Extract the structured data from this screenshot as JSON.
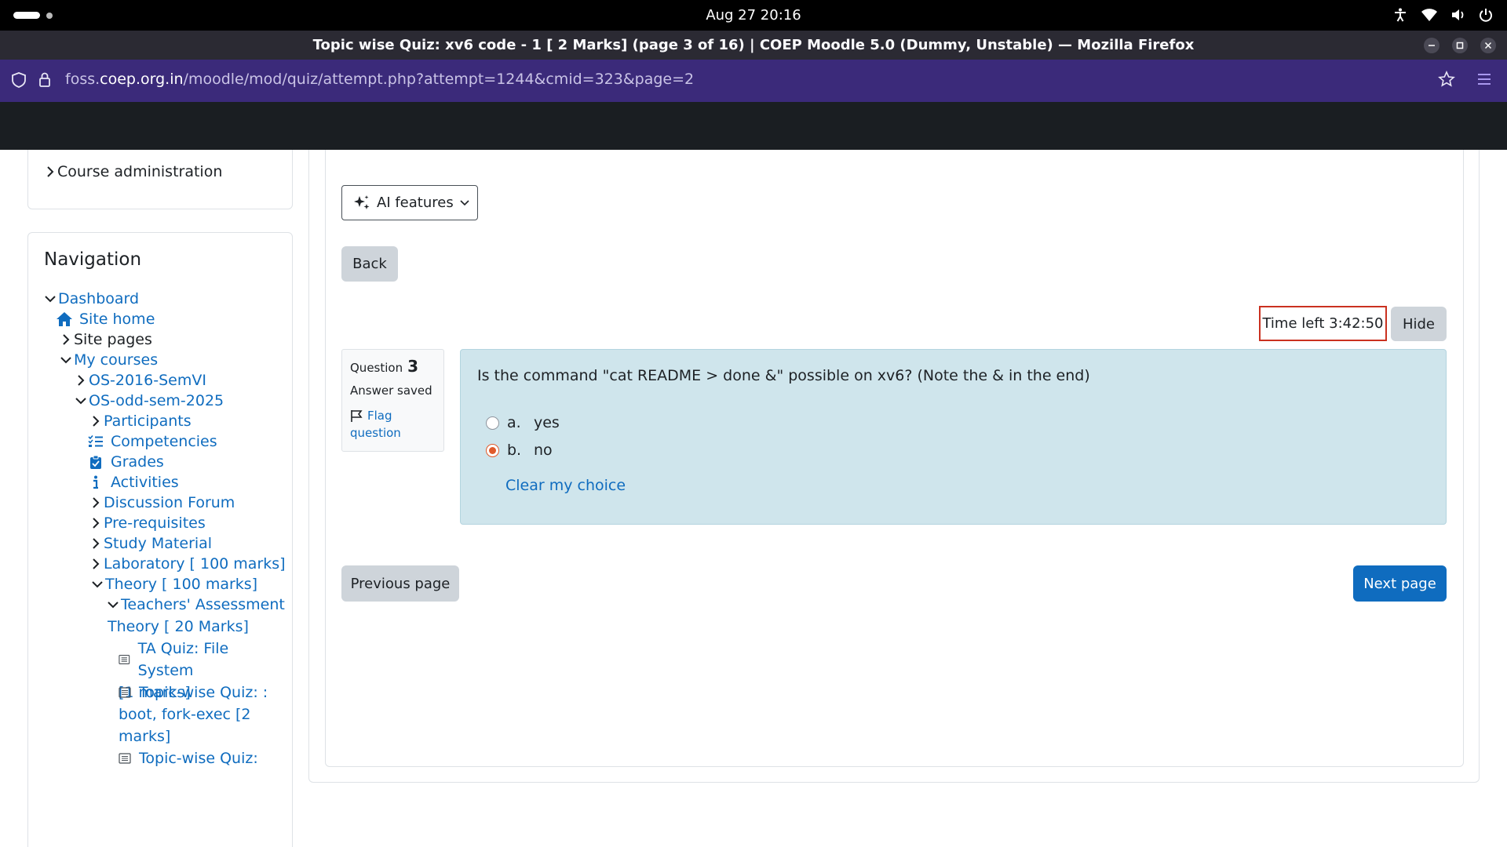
{
  "system": {
    "clock": "Aug 27  20:16"
  },
  "window": {
    "title": "Topic wise Quiz: xv6 code - 1 [ 2 Marks] (page 3 of 16) | COEP Moodle 5.0 (Dummy, Unstable) — Mozilla Firefox"
  },
  "urlbar": {
    "prefix": "foss.",
    "host": "coep.org.in",
    "path": "/moodle/mod/quiz/attempt.php?attempt=1244&cmid=323&page=2"
  },
  "sidebar": {
    "course_admin": "Course administration",
    "nav_title": "Navigation",
    "items": {
      "dashboard": "Dashboard",
      "site_home": "Site home",
      "site_pages": "Site pages",
      "my_courses": "My courses",
      "os2016": "OS-2016-SemVI",
      "osodd": "OS-odd-sem-2025",
      "participants": "Participants",
      "competencies": "Competencies",
      "grades": "Grades",
      "activities": "Activities",
      "forum": "Discussion Forum",
      "prereq": "Pre-requisites",
      "study": "Study Material",
      "lab": "Laboratory [ 100 marks]",
      "theory": "Theory [ 100 marks]",
      "ta_line1": "Teachers' Assessment",
      "ta_line2": "Theory [ 20 Marks]",
      "ta_quiz_line1": "TA Quiz: File System",
      "ta_quiz_line2": "[1 marks]",
      "tw_quiz_line1": "Topic-wise Quiz: :",
      "tw_quiz_line2": "boot, fork-exec [2",
      "tw_quiz_line3": "marks]",
      "tw_quiz2_line1": "Topic-wise Quiz:"
    }
  },
  "main": {
    "ai_features": "AI features",
    "back": "Back",
    "timer": "Time left 3:42:50",
    "hide": "Hide",
    "question": {
      "label": "Question",
      "number": "3",
      "state": "Answer saved",
      "flag_line1": "Flag",
      "flag_line2": "question",
      "text": "Is the command \"cat README > done &\" possible on xv6? (Note the & in the end)",
      "options": [
        {
          "letter": "a.",
          "text": "yes",
          "checked": false
        },
        {
          "letter": "b.",
          "text": "no",
          "checked": true
        }
      ],
      "clear": "Clear my choice"
    },
    "prev": "Previous page",
    "next": "Next page"
  }
}
